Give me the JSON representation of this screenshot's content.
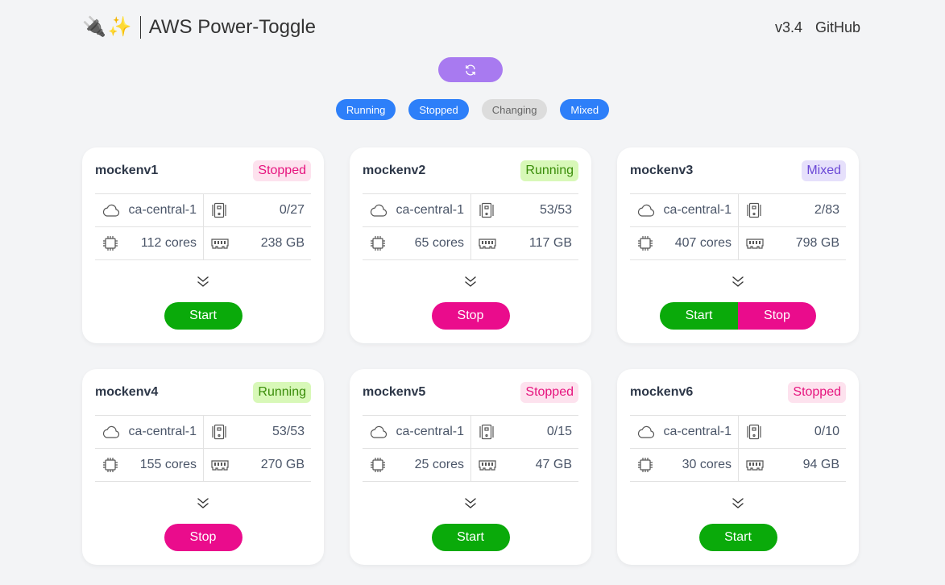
{
  "header": {
    "emoji_plug": "🔌",
    "emoji_sparkles": "✨",
    "title": "AWS Power-Toggle",
    "version": "v3.4",
    "github_label": "GitHub"
  },
  "refresh": {
    "icon": "refresh-icon"
  },
  "filters": [
    {
      "label": "Running",
      "active": true
    },
    {
      "label": "Stopped",
      "active": true
    },
    {
      "label": "Changing",
      "active": false
    },
    {
      "label": "Mixed",
      "active": true
    }
  ],
  "colors": {
    "accent_purple": "#a87af0",
    "filter_blue": "#2d7ff9",
    "start_green": "#0aaa0a",
    "stop_pink": "#ea0c8c"
  },
  "envs": [
    {
      "name": "mockenv1",
      "status": "Stopped",
      "region": "ca-central-1",
      "instances": "0/27",
      "cores": "112 cores",
      "memory": "238 GB",
      "actions": [
        "Start"
      ]
    },
    {
      "name": "mockenv2",
      "status": "Running",
      "region": "ca-central-1",
      "instances": "53/53",
      "cores": "65 cores",
      "memory": "117 GB",
      "actions": [
        "Stop"
      ]
    },
    {
      "name": "mockenv3",
      "status": "Mixed",
      "region": "ca-central-1",
      "instances": "2/83",
      "cores": "407 cores",
      "memory": "798 GB",
      "actions": [
        "Start",
        "Stop"
      ]
    },
    {
      "name": "mockenv4",
      "status": "Running",
      "region": "ca-central-1",
      "instances": "53/53",
      "cores": "155 cores",
      "memory": "270 GB",
      "actions": [
        "Stop"
      ]
    },
    {
      "name": "mockenv5",
      "status": "Stopped",
      "region": "ca-central-1",
      "instances": "0/15",
      "cores": "25 cores",
      "memory": "47 GB",
      "actions": [
        "Start"
      ]
    },
    {
      "name": "mockenv6",
      "status": "Stopped",
      "region": "ca-central-1",
      "instances": "0/10",
      "cores": "30 cores",
      "memory": "94 GB",
      "actions": [
        "Start"
      ]
    }
  ]
}
